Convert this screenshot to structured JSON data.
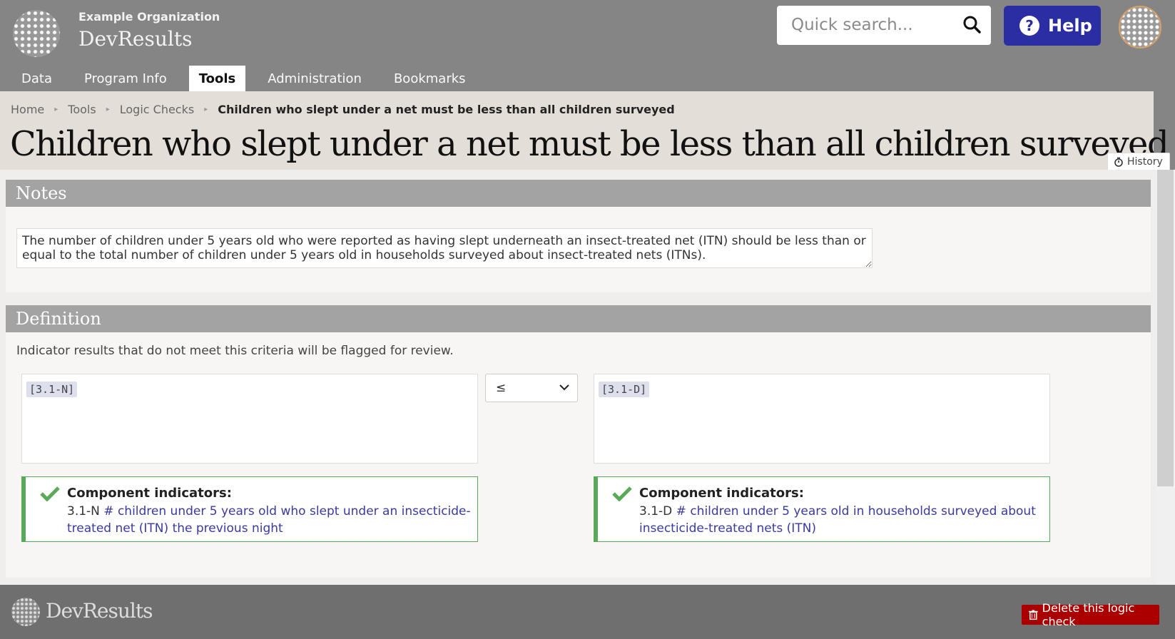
{
  "header": {
    "org_name": "Example Organization",
    "app_name": "DevResults",
    "search_placeholder": "Quick search...",
    "help_label": "Help",
    "help_glyph": "?"
  },
  "nav": {
    "items": [
      {
        "label": "Data",
        "active": false
      },
      {
        "label": "Program Info",
        "active": false
      },
      {
        "label": "Tools",
        "active": true
      },
      {
        "label": "Administration",
        "active": false
      },
      {
        "label": "Bookmarks",
        "active": false
      }
    ]
  },
  "breadcrumb": {
    "items": [
      "Home",
      "Tools",
      "Logic Checks"
    ],
    "current": "Children who slept under a net must be less than all children surveyed"
  },
  "page": {
    "title": "Children who slept under a net must be less than all children surveyed",
    "history_label": "History"
  },
  "notes": {
    "heading": "Notes",
    "text": "The number of children under 5 years old who were reported as having slept underneath an insect-treated net (ITN) should be less than or equal to the total number of children under 5 years old in households surveyed about insect-treated nets (ITNs)."
  },
  "definition": {
    "heading": "Definition",
    "description": "Indicator results that do not meet this criteria will be flagged for review.",
    "left_token": "[3.1-N]",
    "operator": "≤",
    "right_token": "[3.1-D]",
    "component_title": "Component indicators:",
    "left_component": {
      "code": "3.1-N",
      "link": "# children under 5 years old who slept under an insecticide-treated net (ITN) the previous night"
    },
    "right_component": {
      "code": "3.1-D",
      "link": "# children under 5 years old in households surveyed about insecticide-treated nets (ITN)"
    }
  },
  "footer": {
    "brand": "DevResults",
    "delete_label": "Delete this logic check"
  },
  "colors": {
    "help_bg": "#2b2ea3",
    "delete_bg": "#aa0000",
    "success_green": "#5aa85a",
    "link": "#3a3aa0"
  }
}
